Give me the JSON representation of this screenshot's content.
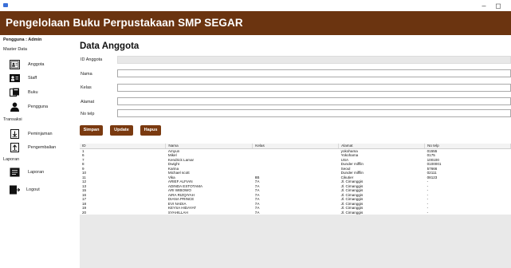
{
  "window": {
    "minimize_glyph": "–",
    "restore_glyph": "◻"
  },
  "header": {
    "title": "Pengelolaan Buku Perpustakaan SMP SEGAR",
    "bg_color": "#6b3410"
  },
  "sidebar": {
    "user_label": "Pengguna : Admin",
    "sections": {
      "master": "Master Data",
      "transaksi": "Transaksi",
      "laporan": "Laporan"
    },
    "items": [
      {
        "label": "Anggota",
        "icon": "member-card-icon"
      },
      {
        "label": "Staff",
        "icon": "staff-icon"
      },
      {
        "label": "Buku",
        "icon": "book-icon"
      },
      {
        "label": "Pengguna",
        "icon": "user-icon"
      },
      {
        "label": "Peminjaman",
        "icon": "borrow-icon"
      },
      {
        "label": "Pengembalian",
        "icon": "return-icon"
      },
      {
        "label": "Laporan",
        "icon": "report-icon"
      },
      {
        "label": "Logout",
        "icon": "logout-icon"
      }
    ]
  },
  "main": {
    "title": "Data Anggota",
    "form": {
      "id_label": "ID Anggota",
      "id_value": "",
      "nama_label": "Nama",
      "nama_value": "",
      "kelas_label": "Kelas",
      "kelas_value": "",
      "alamat_label": "Alamat",
      "alamat_value": "",
      "notelp_label": "No telp",
      "notelp_value": ""
    },
    "buttons": {
      "simpan": "Simpan",
      "update": "Update",
      "hapus": "Hapus"
    },
    "button_color": "#7a3a10",
    "table": {
      "columns": [
        "ID",
        "Nama",
        "Kelas",
        "Alamat",
        "No telp"
      ],
      "rows": [
        [
          "1",
          "Amyun",
          "",
          "yokohama",
          "01555"
        ],
        [
          "6",
          "Mikel",
          "",
          "Yokohama",
          "0175"
        ],
        [
          "7",
          "Kendrick Lamar",
          "",
          "USA",
          "100100"
        ],
        [
          "8",
          "Dwight",
          "",
          "Dunder mifflin",
          "0100001"
        ],
        [
          "9",
          "Karina",
          "",
          "Seoul",
          "57666"
        ],
        [
          "10",
          "Michael scott",
          "",
          "Dunder mifflin",
          "02111"
        ],
        [
          "11",
          "Vika",
          "8B",
          "Cikutier",
          "08123"
        ],
        [
          "12",
          "ARIEF ALFIAN",
          "7A",
          "Jl. Cimanggis",
          "-"
        ],
        [
          "13",
          "ADINDA ESTOTAMA",
          "7A",
          "Jl. Cimanggis",
          "-"
        ],
        [
          "15",
          "ARI WIBOWO",
          "7A",
          "Jl. Cimanggis",
          "-"
        ],
        [
          "16",
          "AIRA RIZQIYAH",
          "7A",
          "Jl. Cimanggis",
          "-"
        ],
        [
          "17",
          "DIANA PRINCE",
          "7A",
          "Jl. Cimanggis",
          "-"
        ],
        [
          "18",
          "EVI NADIA",
          "7A",
          "Jl. Cimanggis",
          "-"
        ],
        [
          "19",
          "KEYSA HIDAYAT",
          "7A",
          "Jl. Cimanggis",
          "-"
        ],
        [
          "20",
          "SYAHILLAH",
          "7A",
          "Jl. Cimanggis",
          "-"
        ]
      ]
    }
  }
}
